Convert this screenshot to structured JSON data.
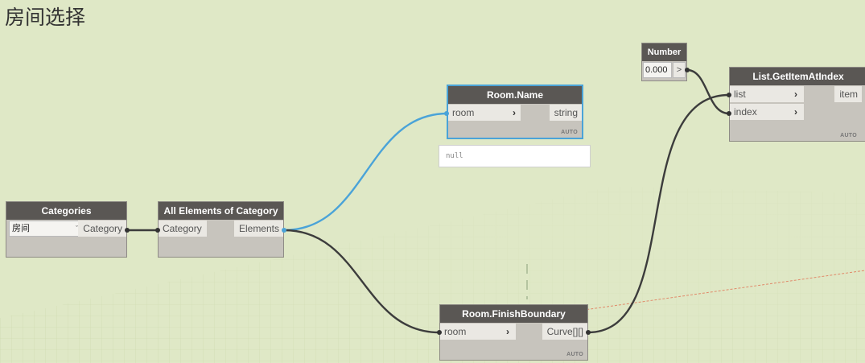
{
  "page_title": "房间选择",
  "nodes": {
    "categories": {
      "title": "Categories",
      "selected_value": "房间",
      "dropdown_arrow": "ˇ",
      "output": "Category"
    },
    "all_elements": {
      "title": "All Elements of Category",
      "input": "Category",
      "output": "Elements"
    },
    "room_name": {
      "title": "Room.Name",
      "input": "room",
      "output": "string",
      "lacing": "AUTO",
      "preview": "null"
    },
    "room_finish_boundary": {
      "title": "Room.FinishBoundary",
      "input": "room",
      "output": "Curve[][]",
      "lacing": "AUTO"
    },
    "number": {
      "title": "Number",
      "value": "0.000",
      "step_button": ">"
    },
    "list_get_item": {
      "title": "List.GetItemAtIndex",
      "inputs": [
        "list",
        "index"
      ],
      "output": "item",
      "lacing": "AUTO"
    }
  },
  "colors": {
    "background": "#dfe8c6",
    "node_header": "#5a5754",
    "node_body": "#c7c4bd",
    "wire": "#3c3c3c",
    "selected_wire": "#4aa3d8"
  }
}
